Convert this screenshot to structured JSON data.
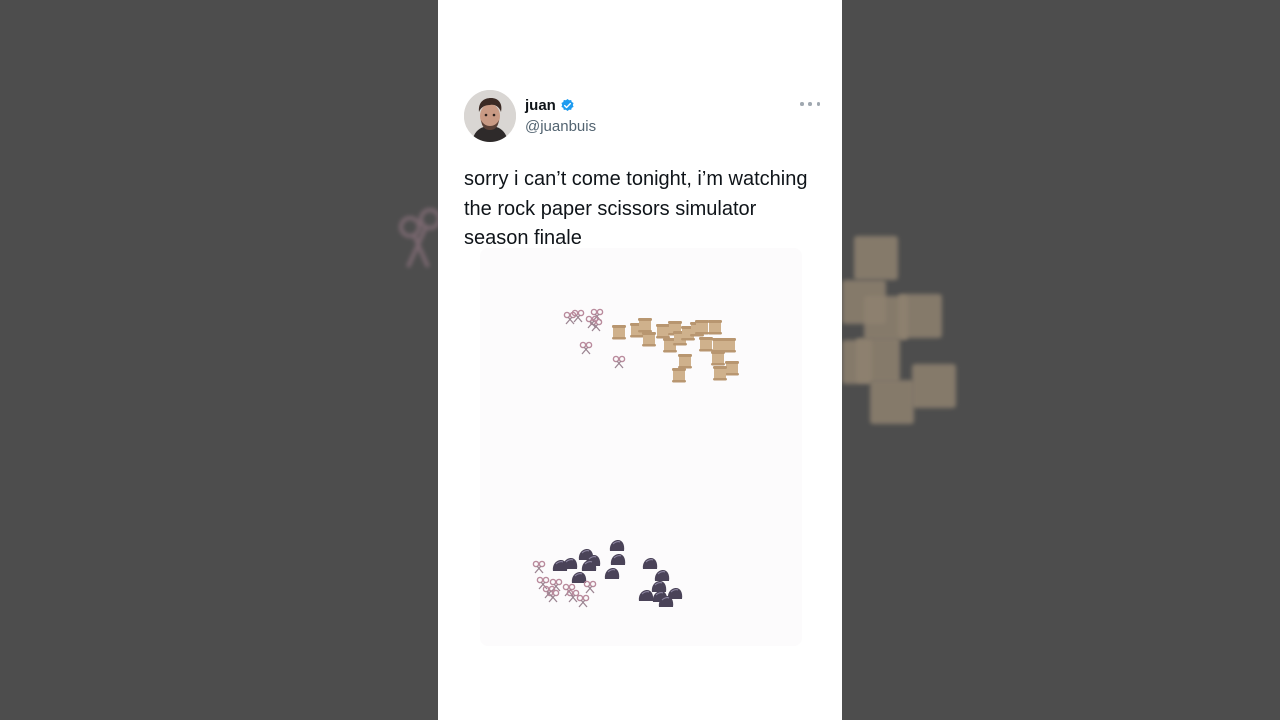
{
  "tweet": {
    "author": {
      "display_name": "juan",
      "handle": "@juanbuis",
      "verified": true,
      "avatar_icon": "avatar-photo-icon"
    },
    "text": "sorry i can’t come tonight, i’m watching the rock paper scissors simulator season finale",
    "more_icon": "more-options-icon",
    "media": {
      "description_icon": "rock-paper-scissors-simulation",
      "colors": {
        "paper": "#c8ab86",
        "rock": "#4a4358",
        "scissors": "#b98a9c"
      }
    }
  },
  "colors": {
    "background": "#4d4d4d",
    "card": "#ffffff",
    "verified_badge": "#1d9bf0",
    "text_primary": "#0f1419",
    "text_secondary": "#536471"
  }
}
